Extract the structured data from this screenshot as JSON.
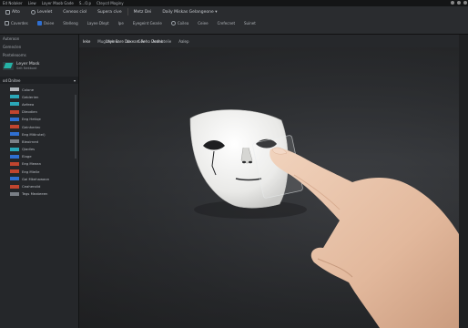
{
  "menubar": {
    "items": [
      "Ed Nolaker",
      "Liew",
      "Layer Maob Gade",
      "S...O.p",
      "Cteycd Moginy"
    ]
  },
  "toolbar": {
    "row1": [
      "Alto",
      "Levelet",
      "Ceneas ciol",
      "Supera cive",
      "Metz Dei",
      "Daily Miskas Gelangeone ▾"
    ],
    "row2": [
      "Coverdes",
      "Oviee",
      "Stelleng",
      "Layee Dlept",
      "Ipe",
      "Eyegeint Gearie",
      "Coilea",
      "Ceiee",
      "Crefecnet",
      "Suinet"
    ]
  },
  "canvas_tabs": [
    "Ieke",
    "Mug Melere",
    "Ve",
    "Coe",
    "Aceehtelie",
    "Aalep"
  ],
  "canvas_doc_title": "Laye Sare Doxeam Reho Dedho",
  "left_panel": {
    "header1": "Auteroon",
    "header2": "Gemeclen",
    "search": "Ponteleooms",
    "layer_name": "Leyer Mask",
    "layer_sub": "Seit Nekkoat",
    "list_title": "od Dnitee",
    "rows": [
      {
        "label": "Colone",
        "color": "#b2b6bb"
      },
      {
        "label": "Geblerien",
        "color": "#2aa7b8"
      },
      {
        "label": "Aefeea",
        "color": "#2aa7b8"
      },
      {
        "label": "Dleodien",
        "color": "#c0452f"
      },
      {
        "label": "Eeg Hetiqe",
        "color": "#2f6fd1"
      },
      {
        "label": "Geinheriec",
        "color": "#c0452f"
      },
      {
        "label": "Eeg Mitirutei)",
        "color": "#2f6fd1"
      },
      {
        "label": "Bleoirned",
        "color": "#7a7f86"
      },
      {
        "label": "Qiadles",
        "color": "#2aa7b8"
      },
      {
        "label": "Elage",
        "color": "#2f6fd1"
      },
      {
        "label": "Eeg Meean",
        "color": "#c0452f"
      },
      {
        "label": "Eeg Mielle",
        "color": "#c0452f"
      },
      {
        "label": "Gai Mkehawaon",
        "color": "#2f6fd1"
      },
      {
        "label": "Ceaheroiid",
        "color": "#c0452f"
      },
      {
        "label": "Tegs Meateeen",
        "color": "#7a7f86"
      }
    ]
  },
  "scene": {
    "description_label": "white mask",
    "mask_color": "#f2f2f0",
    "hand_color": "#e8c3a8"
  }
}
